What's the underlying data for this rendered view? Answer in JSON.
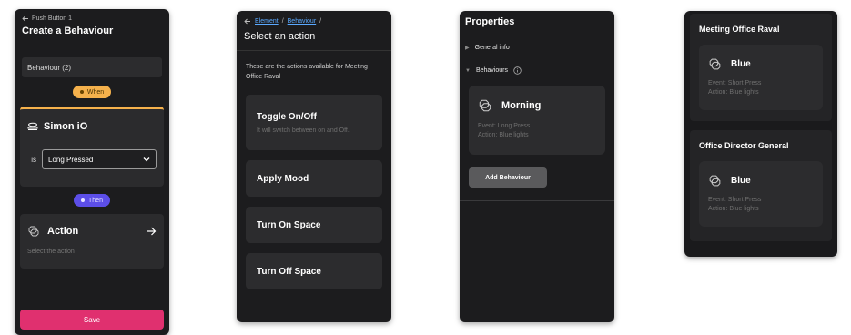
{
  "colors": {
    "accent_when": "#f5b14c",
    "accent_then": "#5c4ee8",
    "save": "#e0306f",
    "link": "#5aa9ff"
  },
  "panel1": {
    "back_label": "Push Button 1",
    "title": "Create a Behaviour",
    "name_value": "Behaviour (2)",
    "when_label": "When",
    "trigger": {
      "icon": "device-icon",
      "title": "Simon iO",
      "is_label": "is",
      "selected_event": "Long Pressed"
    },
    "then_label": "Then",
    "action": {
      "icon": "scenes-icon",
      "title": "Action",
      "subtitle": "Select the action"
    },
    "save_label": "Save"
  },
  "panel2": {
    "breadcrumb": [
      "Element",
      "Behaviour"
    ],
    "separator": "/",
    "title": "Select an action",
    "description": "These are the actions available for Meeting Office Raval",
    "actions": [
      {
        "title": "Toggle On/Off",
        "subtitle": "It will switch between on and Off."
      },
      {
        "title": "Apply Mood",
        "subtitle": ""
      },
      {
        "title": "Turn On Space",
        "subtitle": ""
      },
      {
        "title": "Turn Off Space",
        "subtitle": ""
      }
    ]
  },
  "panel3": {
    "title": "Properties",
    "general_info": "General info",
    "behaviours": "Behaviours",
    "behaviour_card": {
      "title": "Morning",
      "event": "Event: Long Press",
      "action": "Action: Blue lights"
    },
    "add_label": "Add Behaviour"
  },
  "panel4": {
    "rooms": [
      {
        "name": "Meeting Office Raval",
        "card_title": "Blue",
        "event": "Event: Short Press",
        "action": "Action: Blue lights"
      },
      {
        "name": "Office Director General",
        "card_title": "Blue",
        "event": "Event: Short Press",
        "action": "Action: Blue lights"
      }
    ]
  }
}
